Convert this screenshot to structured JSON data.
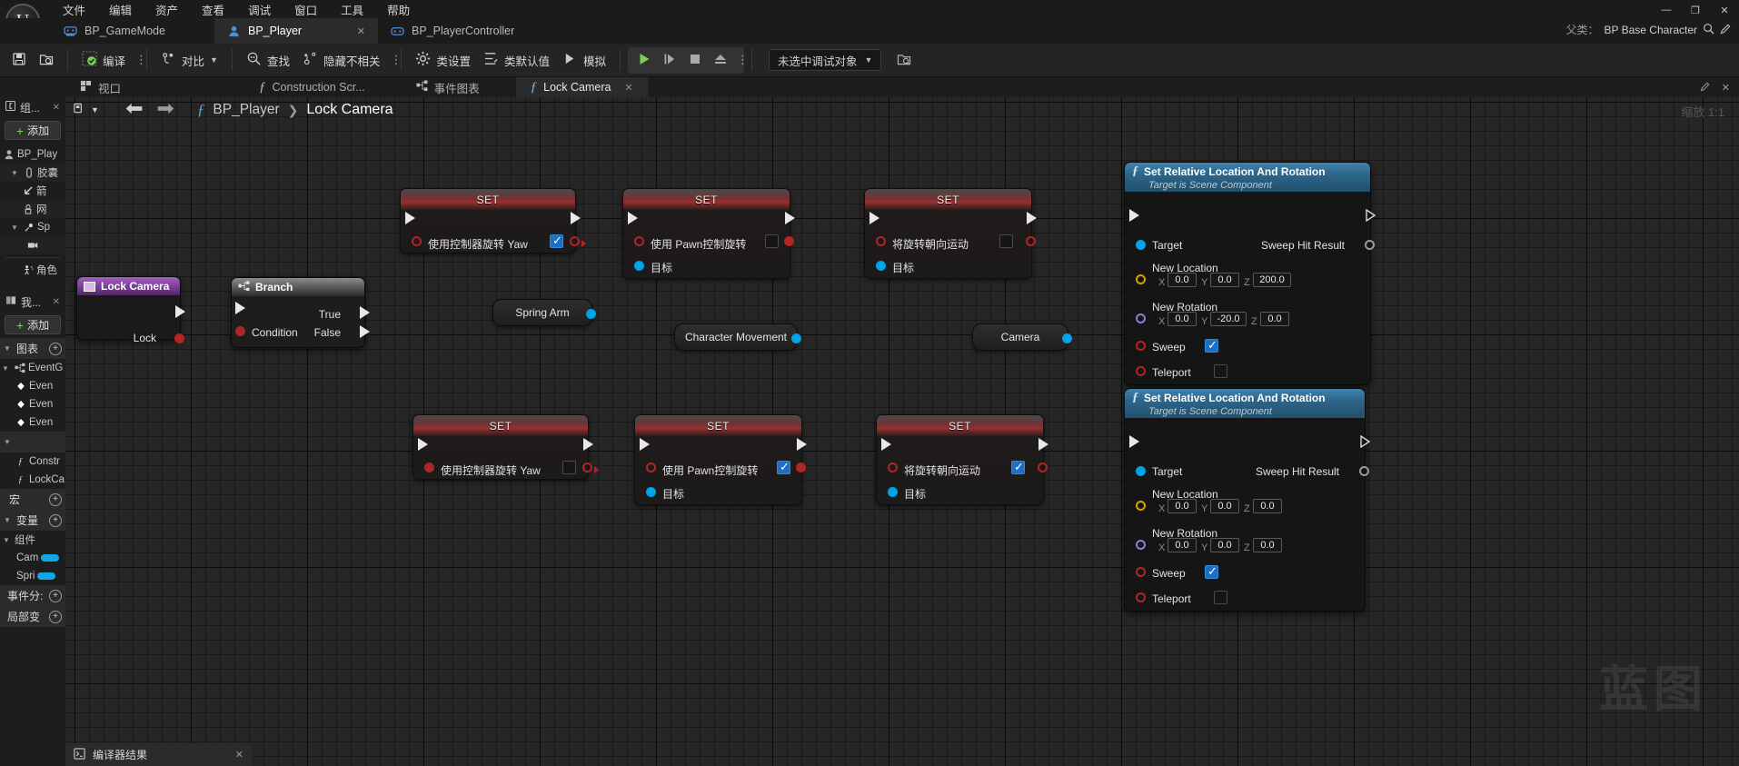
{
  "menu": {
    "items": [
      "文件",
      "编辑",
      "资产",
      "查看",
      "调试",
      "窗口",
      "工具",
      "帮助"
    ],
    "window_controls": [
      "—",
      "❐",
      "✕"
    ]
  },
  "asset_tabs": [
    {
      "label": "BP_GameMode",
      "icon": "gamepad-icon",
      "active": false,
      "closable": false
    },
    {
      "label": "BP_Player",
      "icon": "person-icon",
      "active": true,
      "closable": true,
      "close": "✕"
    },
    {
      "label": "BP_PlayerController",
      "icon": "controller-icon",
      "active": false,
      "closable": false
    }
  ],
  "parent_class": {
    "label": "父类：",
    "value": "BP Base Character",
    "search_icon": "search-icon",
    "edit_icon": "pencil-icon"
  },
  "toolbar": {
    "save_icon": "save-icon",
    "browse_icon": "browse-content-icon",
    "compile": "编译",
    "diff": "对比",
    "find": "查找",
    "hide_unrelated": "隐藏不相关",
    "class_settings": "类设置",
    "class_defaults": "类默认值",
    "simulate": "模拟",
    "play_icon": "play-icon",
    "step_icon": "step-icon",
    "stop_icon": "stop-icon",
    "eject_icon": "eject-icon",
    "overflow": "⋮",
    "debug_object": "未选中调试对象",
    "debug_browse_icon": "browse-debug-icon"
  },
  "doc_tabs": [
    {
      "label": "视口",
      "icon": "viewport-icon",
      "active": false
    },
    {
      "label": "Construction Scr...",
      "icon": "function-icon",
      "active": false
    },
    {
      "label": "事件图表",
      "icon": "graph-icon",
      "active": false
    },
    {
      "label": "Lock Camera",
      "icon": "function-icon",
      "active": true,
      "close": "✕"
    }
  ],
  "doc_tabs_right": {
    "edit_icon": "pencil-icon",
    "close_icon": "✕"
  },
  "components_panel": {
    "title": "组...",
    "close": "✕",
    "add_label": "添加",
    "items": [
      {
        "label": "BP_Play",
        "icon": "actor-icon",
        "indent": 0,
        "arrow": ""
      },
      {
        "label": "胶囊",
        "icon": "capsule-icon",
        "indent": 1,
        "arrow": "▼"
      },
      {
        "label": "箭",
        "icon": "arrow-icon",
        "indent": 2,
        "arrow": ""
      },
      {
        "label": "网",
        "icon": "mesh-icon",
        "indent": 2,
        "arrow": ""
      },
      {
        "label": "Sp",
        "icon": "springarm-icon",
        "indent": 1,
        "arrow": "▼"
      },
      {
        "label": "",
        "icon": "camera-icon",
        "indent": 2,
        "arrow": ""
      },
      {
        "label": "角色",
        "icon": "charactermovement-icon",
        "indent": 1,
        "arrow": ""
      }
    ]
  },
  "myblueprint_panel": {
    "title": "我...",
    "close": "✕",
    "add_label": "添加",
    "sections": [
      {
        "label": "图表",
        "arrow": "▼",
        "plus": "+"
      },
      {
        "label": "宏",
        "arrow": "",
        "plus": "+"
      },
      {
        "label": "变量",
        "arrow": "▼",
        "plus": "+"
      },
      {
        "label": "事件分:",
        "arrow": "",
        "plus": "+"
      },
      {
        "label": "局部变",
        "arrow": "",
        "plus": "+"
      }
    ],
    "graph_items": [
      {
        "label": "EventG",
        "icon": "graph-icon",
        "indent": 1,
        "arrow": "▼"
      },
      {
        "label": "Even",
        "icon": "event-icon",
        "indent": 2,
        "arrow": ""
      },
      {
        "label": "Even",
        "icon": "event-icon",
        "indent": 2,
        "arrow": ""
      },
      {
        "label": "Even",
        "icon": "event-icon",
        "indent": 2,
        "arrow": ""
      }
    ],
    "func_header": {
      "arrow": "▼"
    },
    "func_items": [
      {
        "label": "Constr",
        "icon": "construction-icon"
      },
      {
        "label": "LockCa",
        "icon": "function-icon"
      }
    ],
    "variables_group": {
      "label": "组件",
      "arrow": "▼"
    },
    "variables": [
      {
        "label": "Cam",
        "color": "#12a5e8"
      },
      {
        "label": "Spri",
        "color": "#12a5e8"
      }
    ]
  },
  "graph": {
    "breadcrumb": {
      "fx": "ƒ",
      "parent": "BP_Player",
      "sep": "❯",
      "current": "Lock Camera"
    },
    "back_icon": "back-arrow-icon",
    "forward_icon": "forward-arrow-icon",
    "zoom_label": "缩放 1:1",
    "watermark": "蓝图",
    "nodes": {
      "entry": {
        "title": "Lock Camera",
        "out_pin": "Lock"
      },
      "branch": {
        "title": "Branch",
        "condition": "Condition",
        "true": "True",
        "false": "False"
      },
      "set_top_1": {
        "title": "SET",
        "prop": "使用控制器旋转 Yaw",
        "checked": true
      },
      "set_top_2": {
        "title": "SET",
        "prop": "使用 Pawn控制旋转",
        "checked": false,
        "target": "目标"
      },
      "set_top_3": {
        "title": "SET",
        "prop": "将旋转朝向运动",
        "checked": false,
        "target": "目标"
      },
      "set_bot_1": {
        "title": "SET",
        "prop": "使用控制器旋转 Yaw",
        "checked": false
      },
      "set_bot_2": {
        "title": "SET",
        "prop": "使用 Pawn控制旋转",
        "checked": true,
        "target": "目标"
      },
      "set_bot_3": {
        "title": "SET",
        "prop": "将旋转朝向运动",
        "checked": true,
        "target": "目标"
      },
      "spring_arm": {
        "title": "Spring Arm"
      },
      "character_movement": {
        "title": "Character Movement"
      },
      "camera": {
        "title": "Camera"
      },
      "srlr_top": {
        "title": "Set Relative Location And Rotation",
        "subtitle": "Target is Scene Component",
        "target": "Target",
        "sweep_hit_result": "Sweep Hit Result",
        "new_location_label": "New Location",
        "new_location": {
          "x_label": "X",
          "x": "0.0",
          "y_label": "Y",
          "y": "0.0",
          "z_label": "Z",
          "z": "200.0"
        },
        "new_rotation_label": "New Rotation",
        "new_rotation": {
          "x_label": "X",
          "x": "0.0",
          "y_label": "Y",
          "y": "-20.0",
          "z_label": "Z",
          "z": "0.0"
        },
        "sweep": "Sweep",
        "sweep_checked": true,
        "teleport": "Teleport",
        "teleport_checked": false
      },
      "srlr_bot": {
        "title": "Set Relative Location And Rotation",
        "subtitle": "Target is Scene Component",
        "target": "Target",
        "sweep_hit_result": "Sweep Hit Result",
        "new_location_label": "New Location",
        "new_location": {
          "x_label": "X",
          "x": "0.0",
          "y_label": "Y",
          "y": "0.0",
          "z_label": "Z",
          "z": "0.0"
        },
        "new_rotation_label": "New Rotation",
        "new_rotation": {
          "x_label": "X",
          "x": "0.0",
          "y_label": "Y",
          "y": "0.0",
          "z_label": "Z",
          "z": "0.0"
        },
        "sweep": "Sweep",
        "sweep_checked": true,
        "teleport": "Teleport",
        "teleport_checked": false
      }
    }
  },
  "compiler_results": {
    "label": "编译器结果",
    "icon": "compiler-icon",
    "close": "✕"
  },
  "colors": {
    "accent_blue": "#00a2e8",
    "exec_white": "#e8e8e8",
    "bool_red": "#b02525",
    "vector_yellow": "#d9a300",
    "rotator_purple": "#8c7fd6",
    "compile_green": "#7ccf52"
  }
}
